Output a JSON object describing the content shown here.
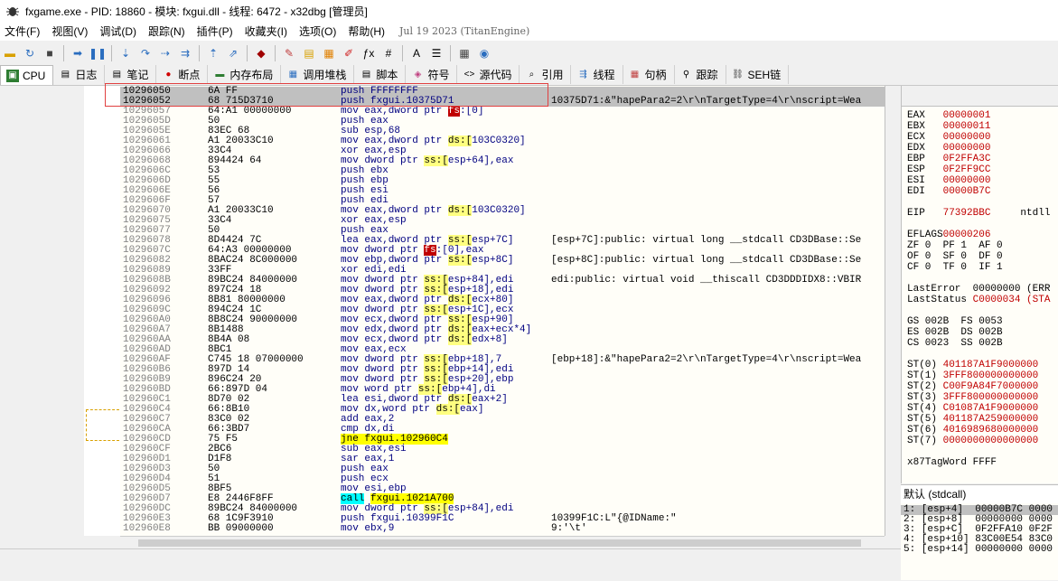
{
  "window": {
    "title": "fxgame.exe - PID: 18860 - 模块: fxgui.dll - 线程: 6472 - x32dbg [管理员]"
  },
  "menu": [
    "文件(F)",
    "视图(V)",
    "调试(D)",
    "跟踪(N)",
    "插件(P)",
    "收藏夹(I)",
    "选项(O)",
    "帮助(H)"
  ],
  "build_info": "Jul 19 2023 (TitanEngine)",
  "tabs": [
    {
      "label": "CPU",
      "icon": "cpu-icon"
    },
    {
      "label": "日志",
      "icon": "log-icon"
    },
    {
      "label": "笔记",
      "icon": "notes-icon"
    },
    {
      "label": "断点",
      "icon": "breakpoint-icon"
    },
    {
      "label": "内存布局",
      "icon": "memory-icon"
    },
    {
      "label": "调用堆栈",
      "icon": "callstack-icon"
    },
    {
      "label": "脚本",
      "icon": "script-icon"
    },
    {
      "label": "符号",
      "icon": "symbol-icon"
    },
    {
      "label": "源代码",
      "icon": "source-icon"
    },
    {
      "label": "引用",
      "icon": "references-icon"
    },
    {
      "label": "线程",
      "icon": "threads-icon"
    },
    {
      "label": "句柄",
      "icon": "handles-icon"
    },
    {
      "label": "跟踪",
      "icon": "trace-icon"
    },
    {
      "label": "SEH链",
      "icon": "seh-icon"
    }
  ],
  "disasm": [
    {
      "addr": "10296050",
      "bytes": "6A FF",
      "instr": "push FFFFFFFF",
      "cmt": ""
    },
    {
      "addr": "10296052",
      "bytes": "68 715D3710",
      "instr": "push fxgui.10375D71",
      "cmt": "10375D71:&\"hapePara2=2\\r\\nTargetType=4\\r\\nscript=Wea"
    },
    {
      "addr": "10296057",
      "bytes": "64:A1 00000000",
      "instr": "mov eax,dword ptr fs:[0]",
      "cmt": ""
    },
    {
      "addr": "1029605D",
      "bytes": "50",
      "instr": "push eax",
      "cmt": ""
    },
    {
      "addr": "1029605E",
      "bytes": "83EC 68",
      "instr": "sub esp,68",
      "cmt": ""
    },
    {
      "addr": "10296061",
      "bytes": "A1 20033C10",
      "instr": "mov eax,dword ptr ds:[103C0320]",
      "cmt": ""
    },
    {
      "addr": "10296066",
      "bytes": "33C4",
      "instr": "xor eax,esp",
      "cmt": ""
    },
    {
      "addr": "10296068",
      "bytes": "894424 64",
      "instr": "mov dword ptr ss:[esp+64],eax",
      "cmt": ""
    },
    {
      "addr": "1029606C",
      "bytes": "53",
      "instr": "push ebx",
      "cmt": ""
    },
    {
      "addr": "1029606D",
      "bytes": "55",
      "instr": "push ebp",
      "cmt": ""
    },
    {
      "addr": "1029606E",
      "bytes": "56",
      "instr": "push esi",
      "cmt": ""
    },
    {
      "addr": "1029606F",
      "bytes": "57",
      "instr": "push edi",
      "cmt": ""
    },
    {
      "addr": "10296070",
      "bytes": "A1 20033C10",
      "instr": "mov eax,dword ptr ds:[103C0320]",
      "cmt": ""
    },
    {
      "addr": "10296075",
      "bytes": "33C4",
      "instr": "xor eax,esp",
      "cmt": ""
    },
    {
      "addr": "10296077",
      "bytes": "50",
      "instr": "push eax",
      "cmt": ""
    },
    {
      "addr": "10296078",
      "bytes": "8D4424 7C",
      "instr": "lea eax,dword ptr ss:[esp+7C]",
      "cmt": "[esp+7C]:public: virtual long __stdcall CD3DBase::Se"
    },
    {
      "addr": "1029607C",
      "bytes": "64:A3 00000000",
      "instr": "mov dword ptr fs:[0],eax",
      "cmt": ""
    },
    {
      "addr": "10296082",
      "bytes": "8BAC24 8C000000",
      "instr": "mov ebp,dword ptr ss:[esp+8C]",
      "cmt": "[esp+8C]:public: virtual long __stdcall CD3DBase::Se"
    },
    {
      "addr": "10296089",
      "bytes": "33FF",
      "instr": "xor edi,edi",
      "cmt": ""
    },
    {
      "addr": "1029608B",
      "bytes": "89BC24 84000000",
      "instr": "mov dword ptr ss:[esp+84],edi",
      "cmt": "edi:public: virtual void __thiscall CD3DDDIDX8::VBIR"
    },
    {
      "addr": "10296092",
      "bytes": "897C24 18",
      "instr": "mov dword ptr ss:[esp+18],edi",
      "cmt": ""
    },
    {
      "addr": "10296096",
      "bytes": "8B81 80000000",
      "instr": "mov eax,dword ptr ds:[ecx+80]",
      "cmt": ""
    },
    {
      "addr": "1029609C",
      "bytes": "894C24 1C",
      "instr": "mov dword ptr ss:[esp+1C],ecx",
      "cmt": ""
    },
    {
      "addr": "102960A0",
      "bytes": "8B8C24 90000000",
      "instr": "mov ecx,dword ptr ss:[esp+90]",
      "cmt": ""
    },
    {
      "addr": "102960A7",
      "bytes": "8B1488",
      "instr": "mov edx,dword ptr ds:[eax+ecx*4]",
      "cmt": ""
    },
    {
      "addr": "102960AA",
      "bytes": "8B4A 08",
      "instr": "mov ecx,dword ptr ds:[edx+8]",
      "cmt": ""
    },
    {
      "addr": "102960AD",
      "bytes": "8BC1",
      "instr": "mov eax,ecx",
      "cmt": ""
    },
    {
      "addr": "102960AF",
      "bytes": "C745 18 07000000",
      "instr": "mov dword ptr ss:[ebp+18],7",
      "cmt": "[ebp+18]:&\"hapePara2=2\\r\\nTargetType=4\\r\\nscript=Wea"
    },
    {
      "addr": "102960B6",
      "bytes": "897D 14",
      "instr": "mov dword ptr ss:[ebp+14],edi",
      "cmt": ""
    },
    {
      "addr": "102960B9",
      "bytes": "896C24 20",
      "instr": "mov dword ptr ss:[esp+20],ebp",
      "cmt": ""
    },
    {
      "addr": "102960BD",
      "bytes": "66:897D 04",
      "instr": "mov word ptr ss:[ebp+4],di",
      "cmt": ""
    },
    {
      "addr": "102960C1",
      "bytes": "8D70 02",
      "instr": "lea esi,dword ptr ds:[eax+2]",
      "cmt": ""
    },
    {
      "addr": "102960C4",
      "bytes": "66:8B10",
      "instr": "mov dx,word ptr ds:[eax]",
      "cmt": ""
    },
    {
      "addr": "102960C7",
      "bytes": "83C0 02",
      "instr": "add eax,2",
      "cmt": ""
    },
    {
      "addr": "102960CA",
      "bytes": "66:3BD7",
      "instr": "cmp dx,di",
      "cmt": ""
    },
    {
      "addr": "102960CD",
      "bytes": "75 F5",
      "instr": "jne fxgui.102960C4",
      "cmt": ""
    },
    {
      "addr": "102960CF",
      "bytes": "2BC6",
      "instr": "sub eax,esi",
      "cmt": ""
    },
    {
      "addr": "102960D1",
      "bytes": "D1F8",
      "instr": "sar eax,1",
      "cmt": ""
    },
    {
      "addr": "102960D3",
      "bytes": "50",
      "instr": "push eax",
      "cmt": ""
    },
    {
      "addr": "102960D4",
      "bytes": "51",
      "instr": "push ecx",
      "cmt": ""
    },
    {
      "addr": "102960D5",
      "bytes": "8BF5",
      "instr": "mov esi,ebp",
      "cmt": ""
    },
    {
      "addr": "102960D7",
      "bytes": "E8 2446F8FF",
      "instr": "call fxgui.1021A700",
      "cmt": ""
    },
    {
      "addr": "102960DC",
      "bytes": "89BC24 84000000",
      "instr": "mov dword ptr ss:[esp+84],edi",
      "cmt": ""
    },
    {
      "addr": "102960E3",
      "bytes": "68 1C9F3910",
      "instr": "push fxgui.10399F1C",
      "cmt": "10399F1C:L\"{@IDName:\""
    },
    {
      "addr": "102960E8",
      "bytes": "BB 09000000",
      "instr": "mov ebx,9",
      "cmt": "9:'\\t'"
    }
  ],
  "registers": [
    {
      "n": "EAX",
      "v": "00000001",
      "extra": ""
    },
    {
      "n": "EBX",
      "v": "00000011",
      "extra": ""
    },
    {
      "n": "ECX",
      "v": "00000000",
      "extra": ""
    },
    {
      "n": "EDX",
      "v": "00000000",
      "extra": ""
    },
    {
      "n": "EBP",
      "v": "0F2FFA3C",
      "extra": ""
    },
    {
      "n": "ESP",
      "v": "0F2FF9CC",
      "extra": ""
    },
    {
      "n": "ESI",
      "v": "00000000",
      "extra": ""
    },
    {
      "n": "EDI",
      "v": "00000B7C",
      "extra": ""
    }
  ],
  "eip": {
    "n": "EIP",
    "v": "77392BBC",
    "extra": "ntdll"
  },
  "eflags": {
    "n": "EFLAGS",
    "v": "00000206"
  },
  "flags": [
    "ZF 0  PF 1  AF 0",
    "OF 0  SF 0  DF 0",
    "CF 0  TF 0  IF 1"
  ],
  "last_error": "LastError  00000000 (ERR",
  "last_status": {
    "label": "LastStatus",
    "v": "C0000034 (STA"
  },
  "segments": [
    "GS 002B  FS 0053",
    "ES 002B  DS 002B",
    "CS 0023  SS 002B"
  ],
  "fpu": [
    {
      "n": "ST(0)",
      "v": "401187A1F9000000"
    },
    {
      "n": "ST(1)",
      "v": "3FFF800000000000"
    },
    {
      "n": "ST(2)",
      "v": "C00F9A84F7000000"
    },
    {
      "n": "ST(3)",
      "v": "3FFF800000000000"
    },
    {
      "n": "ST(4)",
      "v": "C01087A1F9000000"
    },
    {
      "n": "ST(5)",
      "v": "401187A259000000"
    },
    {
      "n": "ST(6)",
      "v": "4016989680000000"
    },
    {
      "n": "ST(7)",
      "v": "0000000000000000"
    }
  ],
  "x87tag": "x87TagWord FFFF",
  "stack_header": "默认 (stdcall)",
  "stack": [
    "1: [esp+4]  00000B7C 0000",
    "2: [esp+8]  00000000 0000",
    "3: [esp+C]  0F2FFA10 0F2F",
    "4: [esp+10] 83C00E54 83C0",
    "5: [esp+14] 00000000 0000"
  ]
}
